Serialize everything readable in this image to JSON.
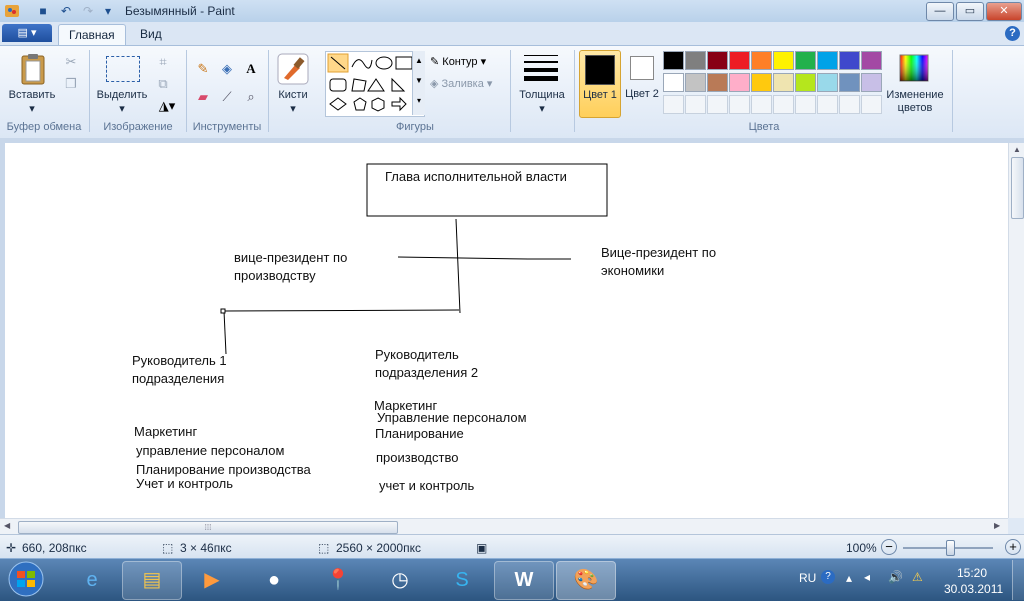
{
  "window": {
    "title": "Безымянный - Paint",
    "min_glyph": "—",
    "max_glyph": "▭",
    "close_glyph": "✕"
  },
  "quick_access": {
    "save_glyph": "■",
    "undo_glyph": "↶",
    "redo_glyph": "↷",
    "customize_glyph": "▾"
  },
  "tabs": [
    {
      "label": "Главная",
      "active": true
    },
    {
      "label": "Вид",
      "active": false
    }
  ],
  "app_menu_glyph": "▤ ▾",
  "help_glyph": "?",
  "ribbon": {
    "clipboard": {
      "paste_label": "Вставить",
      "group_label": "Буфер обмена"
    },
    "image": {
      "select_label": "Выделить",
      "group_label": "Изображение"
    },
    "tools": {
      "group_label": "Инструменты",
      "text_glyph": "A"
    },
    "brushes": {
      "label": "Кисти"
    },
    "shapes": {
      "group_label": "Фигуры",
      "outline_label": "Контур",
      "fill_label": "Заливка"
    },
    "size": {
      "label": "Толщина"
    },
    "colors": {
      "color1_label": "Цвет 1",
      "color2_label": "Цвет 2",
      "edit_label": "Изменение цветов",
      "group_label": "Цвета",
      "color1": "#000000",
      "color2": "#ffffff",
      "palette_row1": [
        "#000000",
        "#7f7f7f",
        "#880015",
        "#ed1c24",
        "#ff7f27",
        "#fff200",
        "#22b14c",
        "#00a2e8",
        "#3f48cc",
        "#a349a4"
      ],
      "palette_row2": [
        "#ffffff",
        "#c3c3c3",
        "#b97a57",
        "#ffaec9",
        "#ffc90e",
        "#efe4b0",
        "#b5e61d",
        "#99d9ea",
        "#7092be",
        "#c8bfe7"
      ]
    }
  },
  "canvas": {
    "texts": {
      "head": "Глава исполнительной власти",
      "vp_prod_1": "вице-президент по",
      "vp_prod_2": "производству",
      "vp_econ_1": "Вице-президент по",
      "vp_econ_2": "экономики",
      "dept1_1": "Руководитель 1",
      "dept1_2": "подразделения",
      "dept2_1": "Руководитель",
      "dept2_2": "подразделения 2",
      "l_marketing": "Маркетинг",
      "l_hr": "управление персоналом",
      "l_plan": "Планирование  производства",
      "l_control": "Учет и контроль",
      "r_marketing": "Маркетинг",
      "r_hr": "Управление персоналом",
      "r_plan": "Планирование",
      "r_prod": "производство",
      "r_control": "учет и контроль"
    }
  },
  "status": {
    "cursor_pos": "660, 208пкс",
    "selection_size": "3 × 46пкс",
    "image_size": "2560 × 2000пкс",
    "zoom": "100%"
  },
  "tray": {
    "lang": "RU",
    "time": "15:20",
    "date": "30.03.2011"
  }
}
